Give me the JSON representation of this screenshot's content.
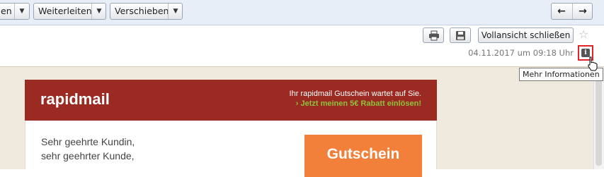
{
  "toolbar": {
    "partial_button_label": "en",
    "forward_button_label": "Weiterleiten",
    "move_button_label": "Verschieben",
    "prev_icon": "arrow-left-icon",
    "next_icon": "arrow-right-icon"
  },
  "header": {
    "close_fullview_label": "Vollansicht schließen",
    "date": "04.11.2017 um 09:18 Uhr",
    "info_icon_letter": "i",
    "tooltip": "Mehr Informationen"
  },
  "email": {
    "brand": "rapidmail",
    "promo_line1": "Ihr rapidmail Gutschein wartet auf Sie.",
    "promo_line2": "› Jetzt meinen 5€ Rabatt einlösen!",
    "greeting1": "Sehr geehrte Kundin,",
    "greeting2": "sehr geehrter Kunde,",
    "cta_label": "Gutschein"
  },
  "colors": {
    "banner": "#9a2a22",
    "promo_accent": "#8fc23a",
    "cta": "#f2803a",
    "highlight_border": "#e0242a"
  }
}
